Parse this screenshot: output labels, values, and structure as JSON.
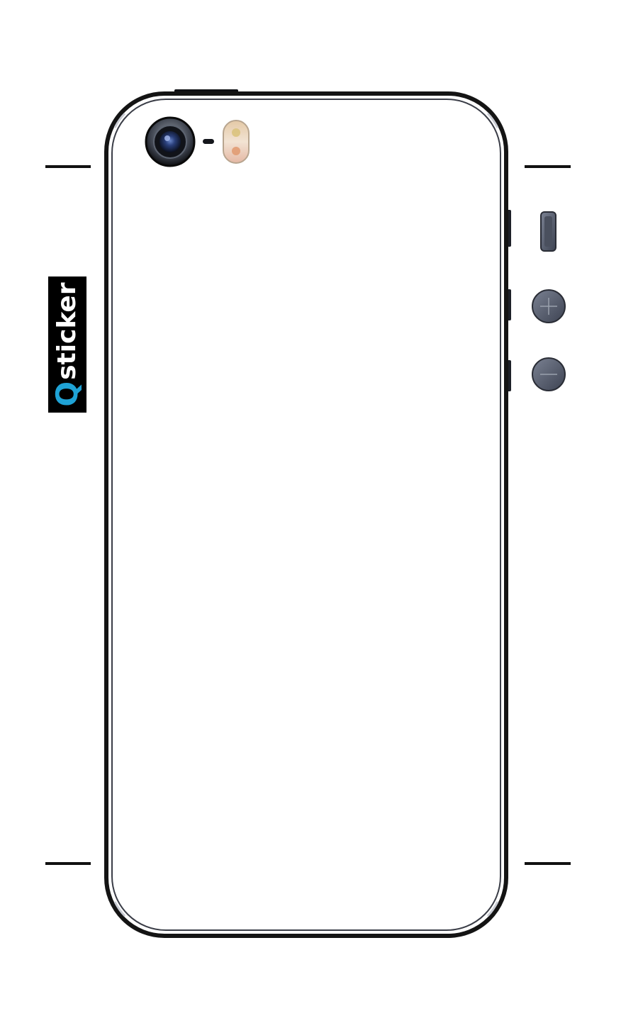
{
  "brand": {
    "logo_q": "Q",
    "logo_rest": "sticker",
    "logo_q_color": "#1fa3d6",
    "logo_text_color": "#ffffff",
    "logo_bg_color": "#000000"
  },
  "colors": {
    "frame": "#111111",
    "frame_edge": "#2a2d36",
    "button": "#5b6272",
    "lens": "#1b2a58",
    "flash": "#e9d8c4",
    "background": "#ffffff"
  },
  "icons": {
    "camera": "camera-lens-icon",
    "flash": "flash-icon",
    "microphone": "microphone-icon",
    "mute": "mute-switch-icon",
    "volume_up": "plus-icon",
    "volume_down": "minus-icon"
  }
}
